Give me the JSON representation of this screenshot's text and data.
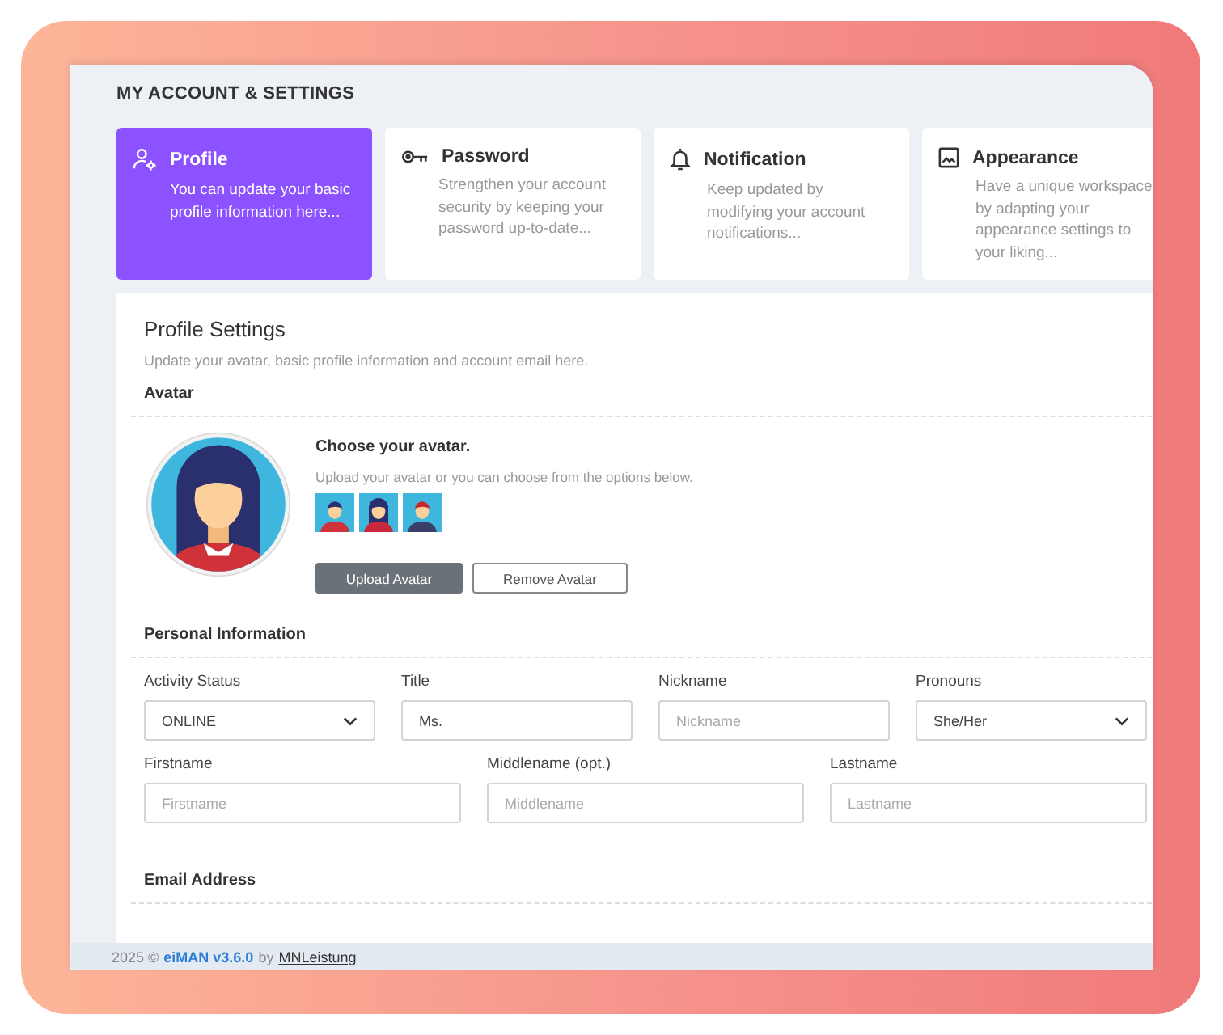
{
  "page_title": "MY ACCOUNT & SETTINGS",
  "tabs": [
    {
      "title": "Profile",
      "description": "You can update your basic profile information here...",
      "selected": true
    },
    {
      "title": "Password",
      "description": "Strengthen your account security by keeping your password up-to-date...",
      "selected": false
    },
    {
      "title": "Notification",
      "description": "Keep updated by modifying your account notifications...",
      "selected": false
    },
    {
      "title": "Appearance",
      "description": "Have a unique workspace by adapting your appearance settings to your liking...",
      "selected": false
    }
  ],
  "panel": {
    "title": "Profile Settings",
    "subtitle": "Update your avatar, basic profile information and account email here.",
    "avatar_section": {
      "heading": "Avatar",
      "choose_title": "Choose your avatar.",
      "choose_hint": "Upload your avatar or you can choose from the options below.",
      "buttons": [
        {
          "label": "Upload Avatar",
          "kind": "primary"
        },
        {
          "label": "Remove Avatar",
          "kind": "outline"
        }
      ]
    },
    "personal_section": {
      "heading": "Personal Information",
      "rows": [
        [
          {
            "label": "Activity Status",
            "kind": "select",
            "value": "ONLINE"
          },
          {
            "label": "Title",
            "kind": "input",
            "value": "Ms."
          },
          {
            "label": "Nickname",
            "kind": "input",
            "placeholder": "Nickname"
          },
          {
            "label": "Pronouns",
            "kind": "select",
            "value": "She/Her"
          }
        ],
        [
          {
            "label": "Firstname",
            "kind": "input",
            "placeholder": "Firstname"
          },
          {
            "label": "Middlename (opt.)",
            "kind": "input",
            "placeholder": "Middlename"
          },
          {
            "label": "Lastname",
            "kind": "input",
            "placeholder": "Lastname"
          }
        ]
      ]
    },
    "email_section": {
      "heading": "Email Address"
    }
  },
  "footer": {
    "year": "2025 ©",
    "product": "eiMAN v3.6.0",
    "by": "by",
    "author": "MNLeistung"
  }
}
